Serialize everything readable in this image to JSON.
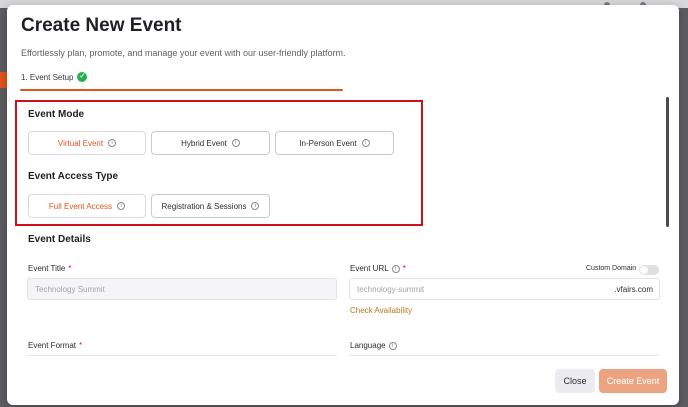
{
  "modal": {
    "title": "Create New Event",
    "subtitle": "Effortlessly plan, promote, and manage your event with our user-friendly platform.",
    "step_label": "1. Event Setup",
    "step_done_icon": "check-circle-icon"
  },
  "event_mode": {
    "title": "Event Mode",
    "options": [
      {
        "label": "Virtual Event",
        "selected": true
      },
      {
        "label": "Hybrid Event",
        "selected": false
      },
      {
        "label": "In-Person Event",
        "selected": false
      }
    ]
  },
  "access_type": {
    "title": "Event Access Type",
    "options": [
      {
        "label": "Full Event Access",
        "selected": true
      },
      {
        "label": "Registration & Sessions",
        "selected": false
      }
    ]
  },
  "details": {
    "title": "Event Details",
    "event_title_label": "Event Title",
    "event_title_placeholder": "Technology Summit",
    "event_url_label": "Event URL",
    "event_url_placeholder": "technology-summit",
    "event_url_suffix": ".vfairs.com",
    "custom_domain_label": "Custom Domain",
    "check_availability": "Check Availability",
    "event_format_label": "Event Format",
    "language_label": "Language",
    "required_mark": "*"
  },
  "footer": {
    "close_label": "Close",
    "create_label": "Create Event"
  },
  "colors": {
    "accent": "#e3541c",
    "highlight_border": "#d0101c",
    "create_button": "#eca382",
    "link": "#b77a1a"
  }
}
